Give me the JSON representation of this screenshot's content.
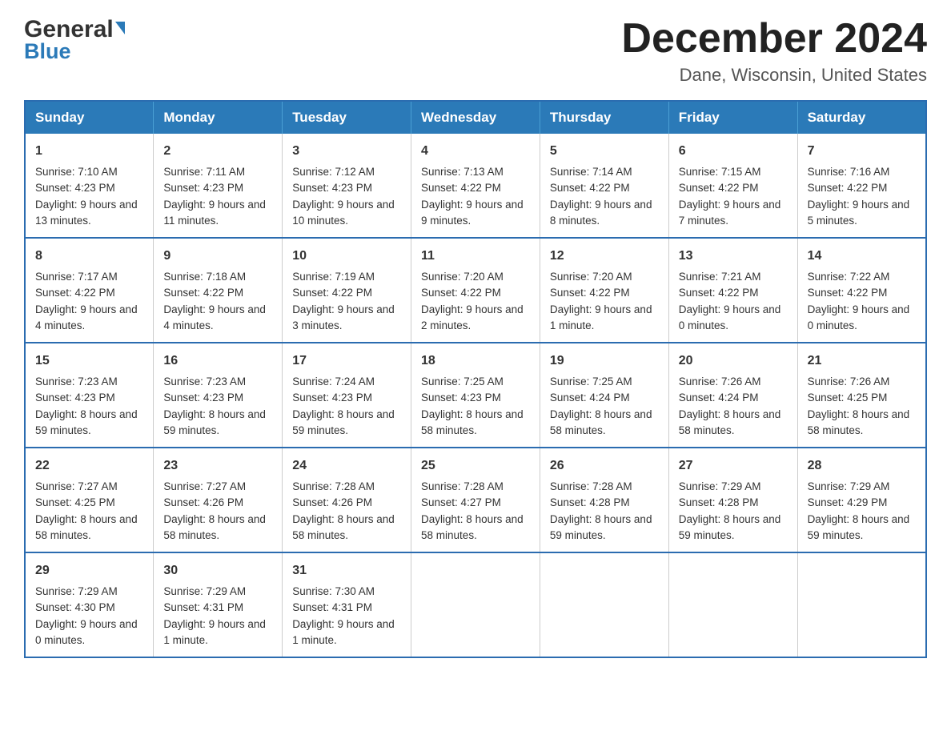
{
  "header": {
    "logo": {
      "general": "General",
      "blue": "Blue",
      "arrow": "▶"
    },
    "title": "December 2024",
    "subtitle": "Dane, Wisconsin, United States"
  },
  "days_of_week": [
    "Sunday",
    "Monday",
    "Tuesday",
    "Wednesday",
    "Thursday",
    "Friday",
    "Saturday"
  ],
  "weeks": [
    [
      {
        "day": "1",
        "sunrise": "7:10 AM",
        "sunset": "4:23 PM",
        "daylight": "9 hours and 13 minutes."
      },
      {
        "day": "2",
        "sunrise": "7:11 AM",
        "sunset": "4:23 PM",
        "daylight": "9 hours and 11 minutes."
      },
      {
        "day": "3",
        "sunrise": "7:12 AM",
        "sunset": "4:23 PM",
        "daylight": "9 hours and 10 minutes."
      },
      {
        "day": "4",
        "sunrise": "7:13 AM",
        "sunset": "4:22 PM",
        "daylight": "9 hours and 9 minutes."
      },
      {
        "day": "5",
        "sunrise": "7:14 AM",
        "sunset": "4:22 PM",
        "daylight": "9 hours and 8 minutes."
      },
      {
        "day": "6",
        "sunrise": "7:15 AM",
        "sunset": "4:22 PM",
        "daylight": "9 hours and 7 minutes."
      },
      {
        "day": "7",
        "sunrise": "7:16 AM",
        "sunset": "4:22 PM",
        "daylight": "9 hours and 5 minutes."
      }
    ],
    [
      {
        "day": "8",
        "sunrise": "7:17 AM",
        "sunset": "4:22 PM",
        "daylight": "9 hours and 4 minutes."
      },
      {
        "day": "9",
        "sunrise": "7:18 AM",
        "sunset": "4:22 PM",
        "daylight": "9 hours and 4 minutes."
      },
      {
        "day": "10",
        "sunrise": "7:19 AM",
        "sunset": "4:22 PM",
        "daylight": "9 hours and 3 minutes."
      },
      {
        "day": "11",
        "sunrise": "7:20 AM",
        "sunset": "4:22 PM",
        "daylight": "9 hours and 2 minutes."
      },
      {
        "day": "12",
        "sunrise": "7:20 AM",
        "sunset": "4:22 PM",
        "daylight": "9 hours and 1 minute."
      },
      {
        "day": "13",
        "sunrise": "7:21 AM",
        "sunset": "4:22 PM",
        "daylight": "9 hours and 0 minutes."
      },
      {
        "day": "14",
        "sunrise": "7:22 AM",
        "sunset": "4:22 PM",
        "daylight": "9 hours and 0 minutes."
      }
    ],
    [
      {
        "day": "15",
        "sunrise": "7:23 AM",
        "sunset": "4:23 PM",
        "daylight": "8 hours and 59 minutes."
      },
      {
        "day": "16",
        "sunrise": "7:23 AM",
        "sunset": "4:23 PM",
        "daylight": "8 hours and 59 minutes."
      },
      {
        "day": "17",
        "sunrise": "7:24 AM",
        "sunset": "4:23 PM",
        "daylight": "8 hours and 59 minutes."
      },
      {
        "day": "18",
        "sunrise": "7:25 AM",
        "sunset": "4:23 PM",
        "daylight": "8 hours and 58 minutes."
      },
      {
        "day": "19",
        "sunrise": "7:25 AM",
        "sunset": "4:24 PM",
        "daylight": "8 hours and 58 minutes."
      },
      {
        "day": "20",
        "sunrise": "7:26 AM",
        "sunset": "4:24 PM",
        "daylight": "8 hours and 58 minutes."
      },
      {
        "day": "21",
        "sunrise": "7:26 AM",
        "sunset": "4:25 PM",
        "daylight": "8 hours and 58 minutes."
      }
    ],
    [
      {
        "day": "22",
        "sunrise": "7:27 AM",
        "sunset": "4:25 PM",
        "daylight": "8 hours and 58 minutes."
      },
      {
        "day": "23",
        "sunrise": "7:27 AM",
        "sunset": "4:26 PM",
        "daylight": "8 hours and 58 minutes."
      },
      {
        "day": "24",
        "sunrise": "7:28 AM",
        "sunset": "4:26 PM",
        "daylight": "8 hours and 58 minutes."
      },
      {
        "day": "25",
        "sunrise": "7:28 AM",
        "sunset": "4:27 PM",
        "daylight": "8 hours and 58 minutes."
      },
      {
        "day": "26",
        "sunrise": "7:28 AM",
        "sunset": "4:28 PM",
        "daylight": "8 hours and 59 minutes."
      },
      {
        "day": "27",
        "sunrise": "7:29 AM",
        "sunset": "4:28 PM",
        "daylight": "8 hours and 59 minutes."
      },
      {
        "day": "28",
        "sunrise": "7:29 AM",
        "sunset": "4:29 PM",
        "daylight": "8 hours and 59 minutes."
      }
    ],
    [
      {
        "day": "29",
        "sunrise": "7:29 AM",
        "sunset": "4:30 PM",
        "daylight": "9 hours and 0 minutes."
      },
      {
        "day": "30",
        "sunrise": "7:29 AM",
        "sunset": "4:31 PM",
        "daylight": "9 hours and 1 minute."
      },
      {
        "day": "31",
        "sunrise": "7:30 AM",
        "sunset": "4:31 PM",
        "daylight": "9 hours and 1 minute."
      },
      null,
      null,
      null,
      null
    ]
  ],
  "labels": {
    "sunrise": "Sunrise:",
    "sunset": "Sunset:",
    "daylight": "Daylight:"
  }
}
